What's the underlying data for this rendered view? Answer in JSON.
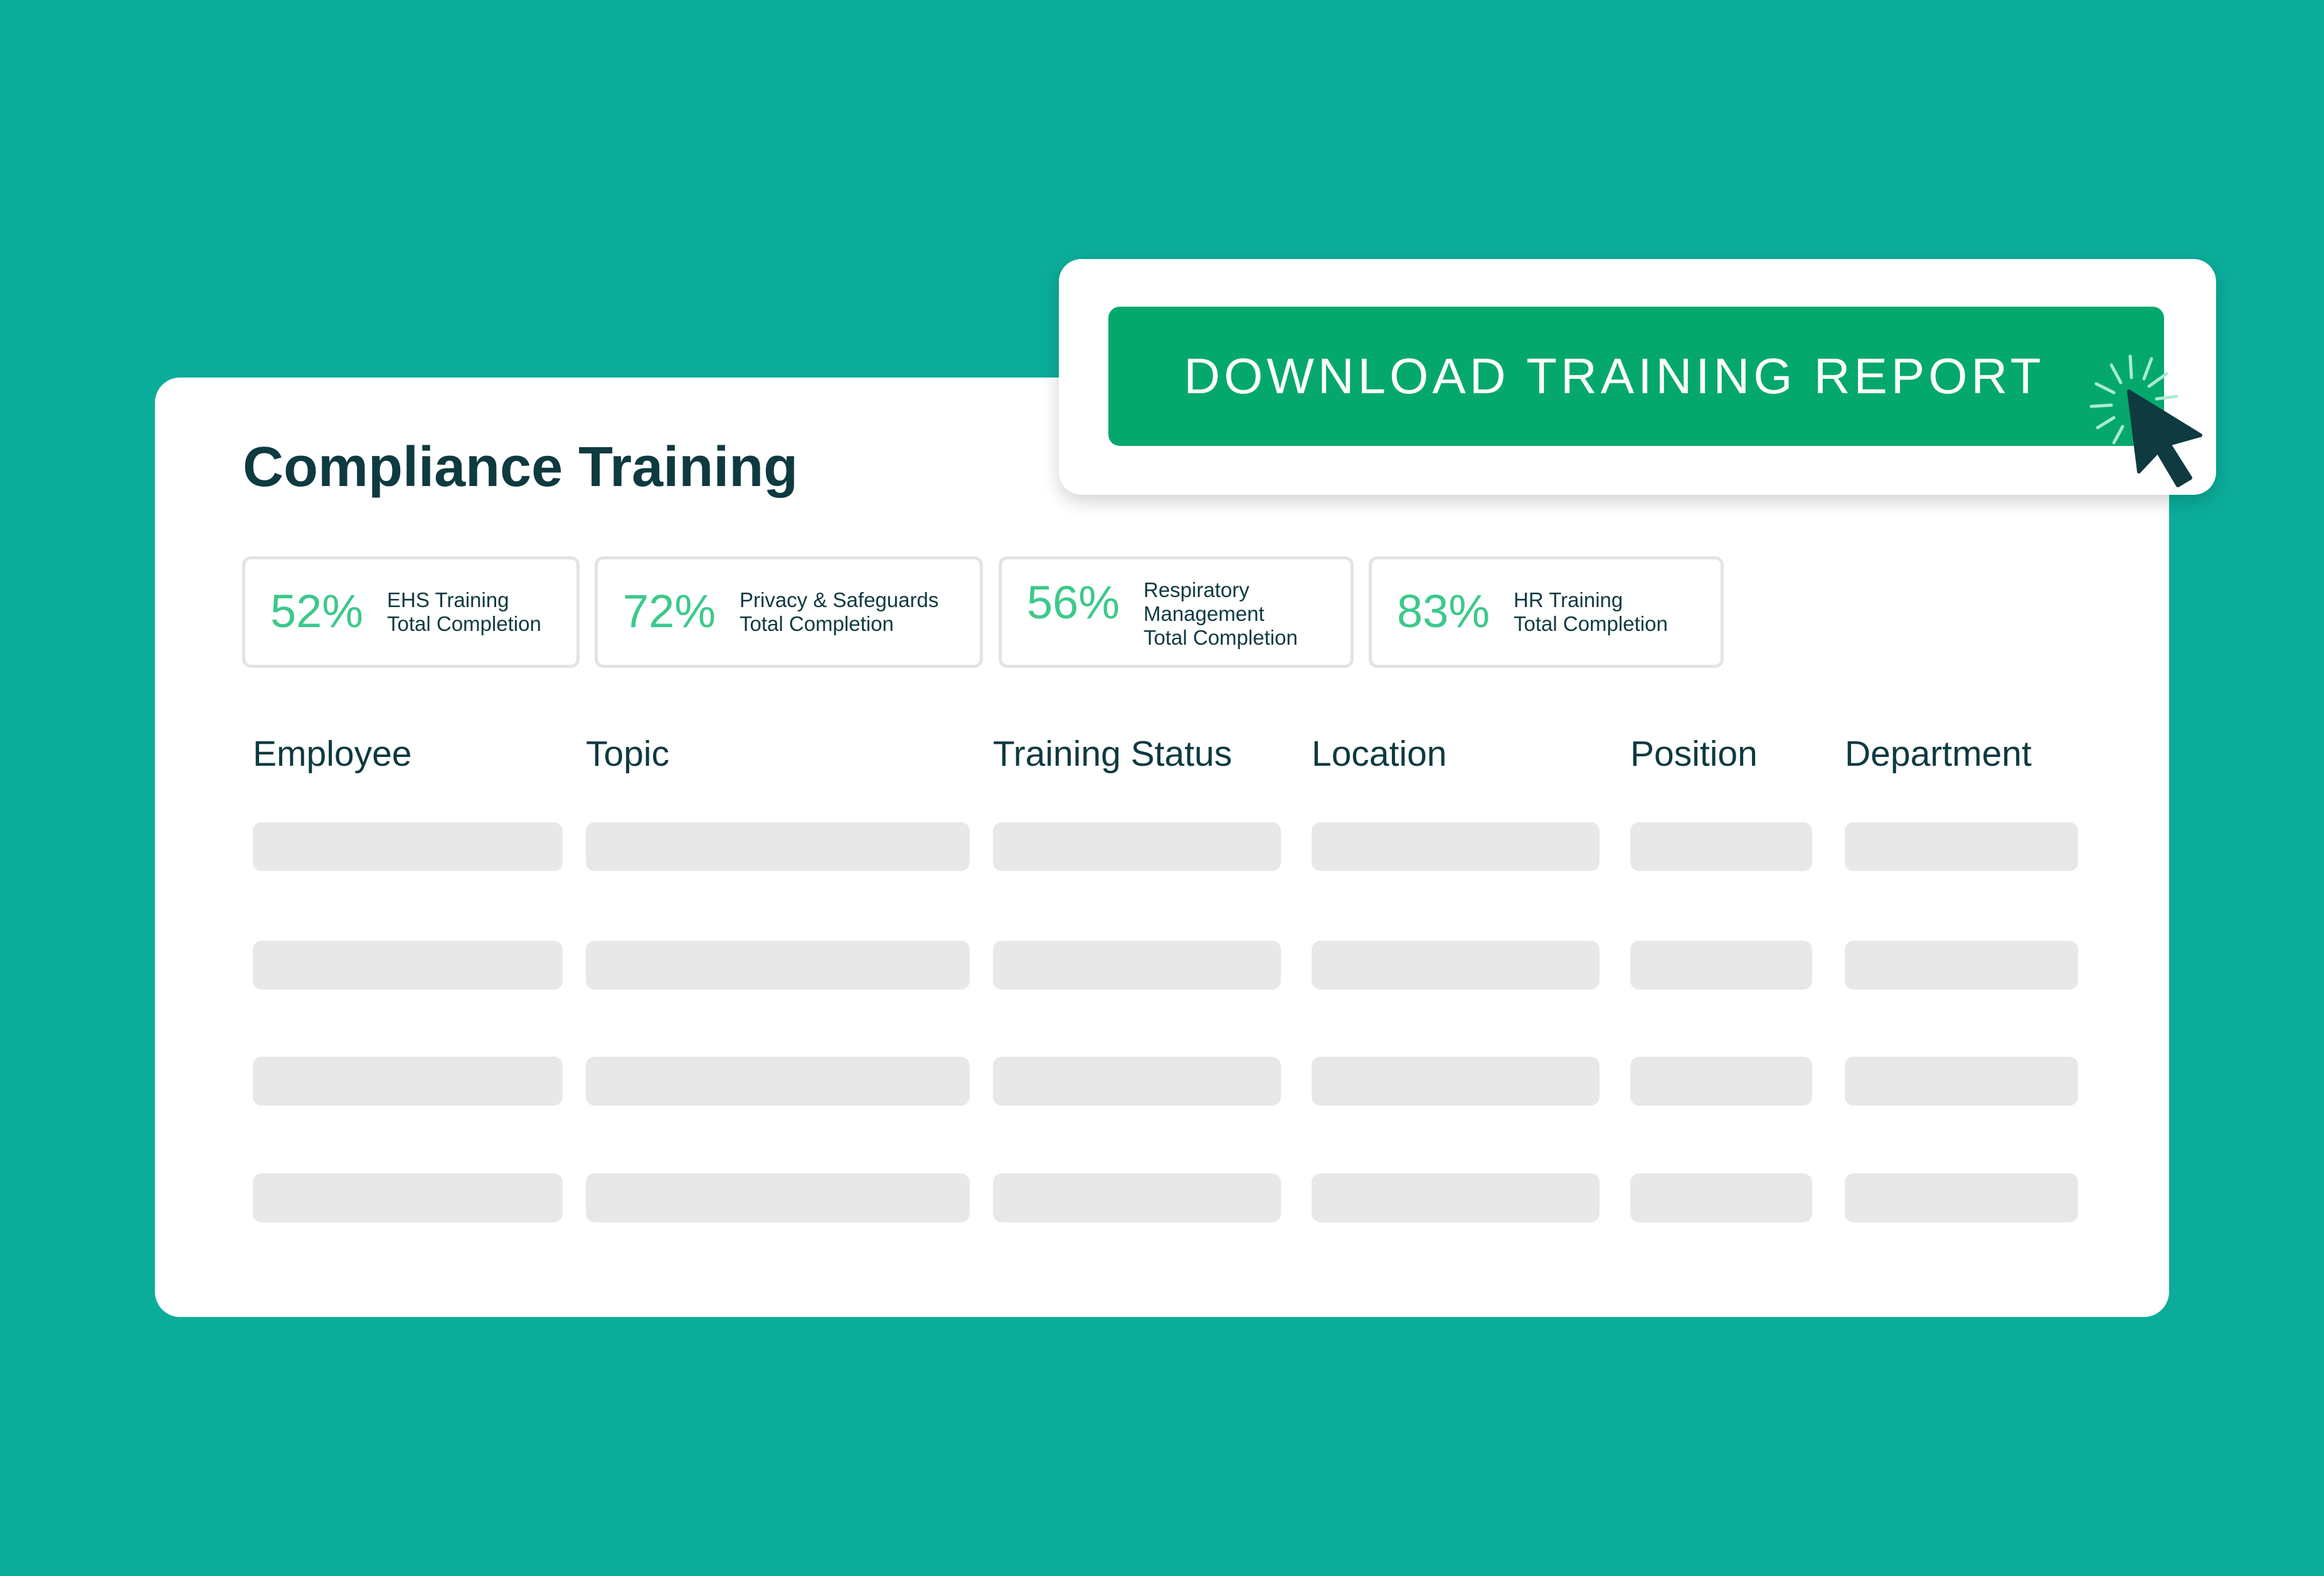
{
  "panel": {
    "title": "Compliance Training"
  },
  "stats": [
    {
      "percent": "52%",
      "lines": [
        "EHS Training",
        "Total Completion"
      ]
    },
    {
      "percent": "72%",
      "lines": [
        "Privacy & Safeguards",
        "Total Completion"
      ]
    },
    {
      "percent": "56%",
      "lines": [
        "Respiratory",
        "Management",
        "Total Completion"
      ]
    },
    {
      "percent": "83%",
      "lines": [
        "HR Training",
        "Total Completion"
      ]
    }
  ],
  "table": {
    "columns": [
      "Employee",
      "Topic",
      "Training Status",
      "Location",
      "Position",
      "Department"
    ],
    "placeholder_rows": 4
  },
  "download_button": {
    "label": "DOWNLOAD TRAINING REPORT"
  },
  "colors": {
    "background": "#0bad9a",
    "button": "#04a86d",
    "percent_text": "#3cc98b",
    "heading_text": "#0e3a40",
    "placeholder": "#e8e8e8"
  },
  "icons": {
    "cursor": "pointer-cursor-icon",
    "click_burst": "click-burst-icon"
  }
}
